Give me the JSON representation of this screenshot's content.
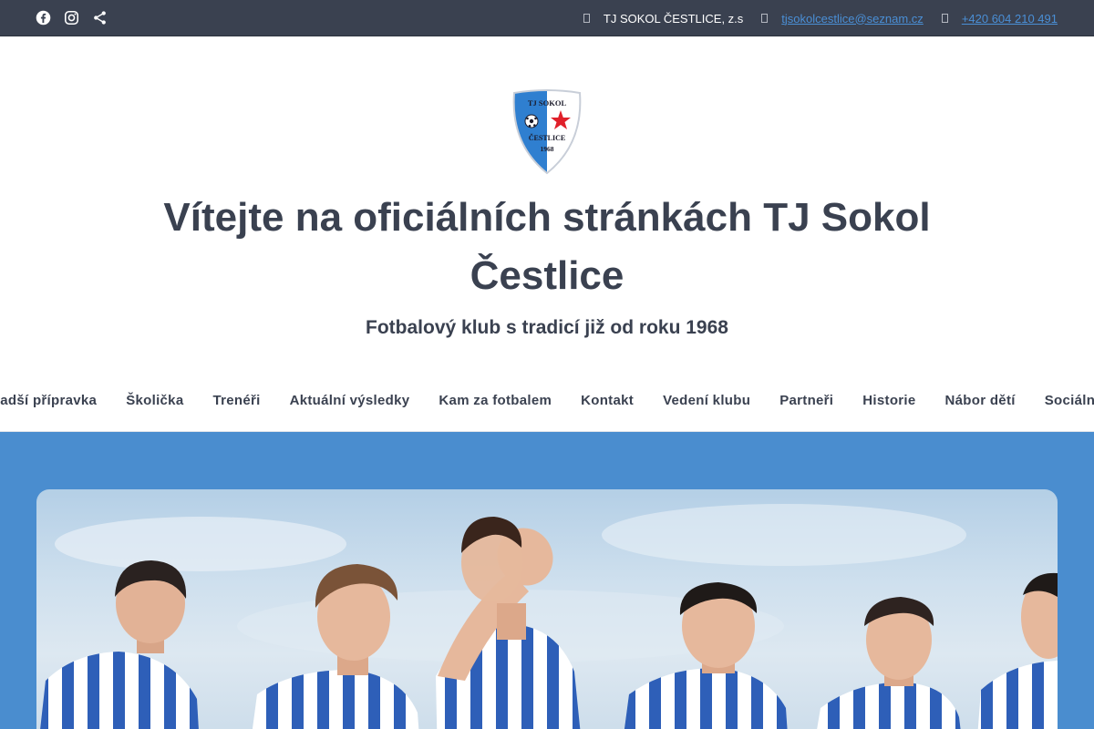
{
  "topbar": {
    "social_icons": [
      "facebook-icon",
      "instagram-icon",
      "share-icon"
    ],
    "club_name": "TJ SOKOL ČESTLICE, z.s",
    "email": "tjsokolcestlice@seznam.cz",
    "phone": "+420 604 210 491"
  },
  "logo": {
    "text_top": "TJ SOKOL",
    "text_bottom": "ČESTLICE",
    "year": "1968"
  },
  "header": {
    "title_line1": "Vítejte na oficiálních stránkách TJ Sokol",
    "title_line2": "Čestlice",
    "tagline": "Fotbalový klub s tradicí již od roku 1968"
  },
  "nav": {
    "items": [
      "Mladší přípravka",
      "Školička",
      "Trenéři",
      "Aktuální výsledky",
      "Kam za fotbalem",
      "Kontakt",
      "Vedení klubu",
      "Partneři",
      "Historie",
      "Nábor dětí",
      "Sociální sítě"
    ]
  },
  "colors": {
    "topbar_bg": "#3a4150",
    "text_dark": "#3a4150",
    "link_blue": "#4a8fd6",
    "hero_bg": "#4a8dcf",
    "jersey_blue": "#2e5fb8"
  }
}
